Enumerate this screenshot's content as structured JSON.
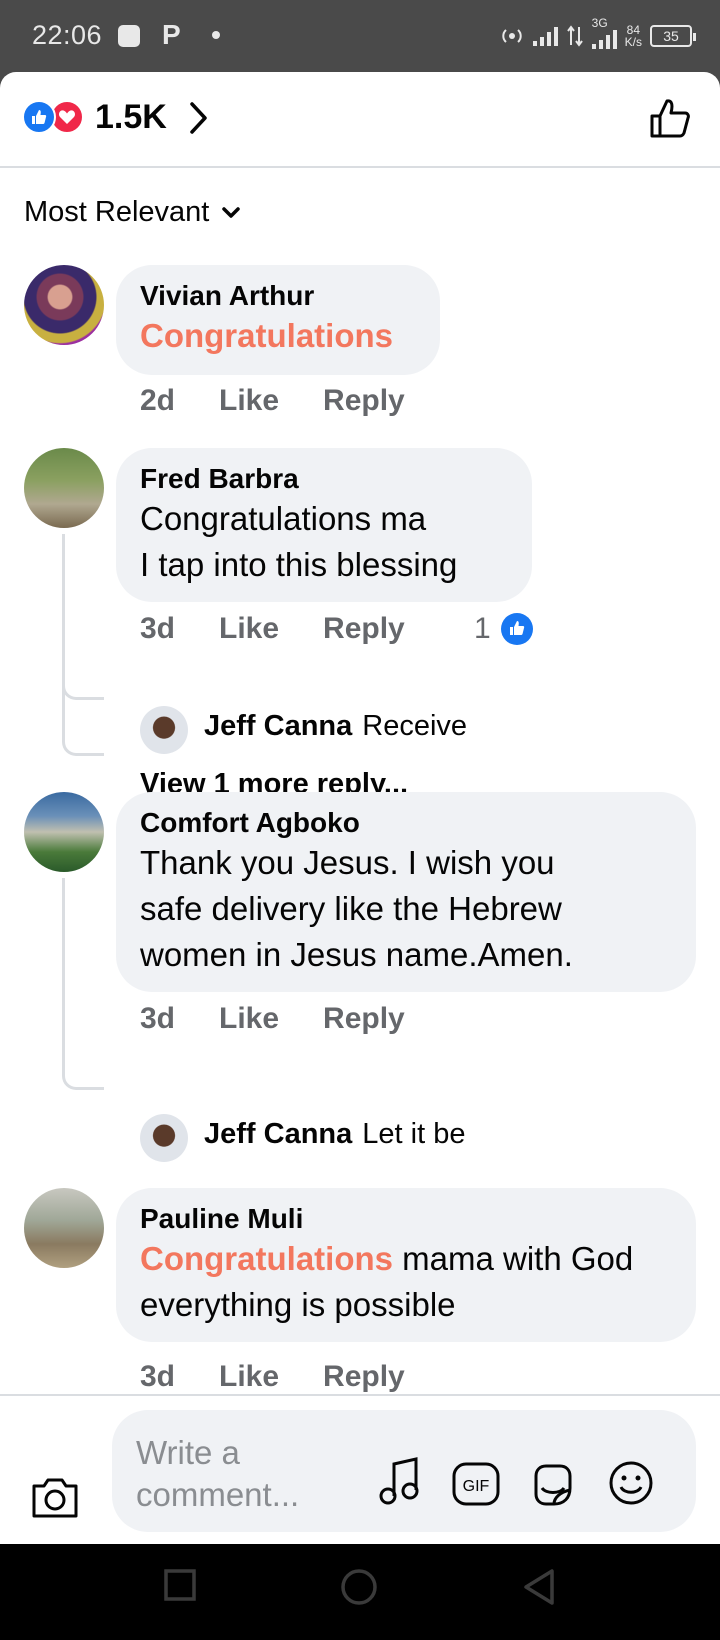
{
  "status_bar": {
    "time": "22:06",
    "p_glyph": "P",
    "net_gen": "3G",
    "net_speed_num": "84",
    "net_speed_unit": "K/s",
    "battery": "35"
  },
  "reactions": {
    "count": "1.5K",
    "icons": [
      "like-icon",
      "love-icon"
    ]
  },
  "sort": {
    "label": "Most Relevant"
  },
  "comments": [
    {
      "author": "Vivian Arthur",
      "text_highlight": "Congratulations",
      "text": "",
      "time": "2d",
      "like_label": "Like",
      "reply_label": "Reply"
    },
    {
      "author": "Fred Barbra",
      "text_line1": "Congratulations ma",
      "text_line2": "I tap into this blessing",
      "time": "3d",
      "like_label": "Like",
      "reply_label": "Reply",
      "like_count": "1",
      "replies": [
        {
          "author": "Jeff Canna",
          "text": "Receive"
        }
      ],
      "view_more": "View 1 more reply..."
    },
    {
      "author": "Comfort Agboko",
      "text_line1": "Thank you Jesus. I wish you",
      "text_line2": "safe delivery like the Hebrew",
      "text_line3": "women in Jesus name.Amen.",
      "time": "3d",
      "like_label": "Like",
      "reply_label": "Reply",
      "replies": [
        {
          "author": "Jeff Canna",
          "text": "Let it be"
        }
      ]
    },
    {
      "author": "Pauline Muli",
      "text_highlight": "Congratulations",
      "text_rest": " mama with God",
      "text_line2": "everything is possible",
      "time": "3d",
      "like_label": "Like",
      "reply_label": "Reply"
    }
  ],
  "composer": {
    "placeholder": "Write a comment...",
    "icons": [
      "camera-icon",
      "music-note-icon",
      "gif-icon",
      "sticker-icon",
      "emoji-icon"
    ]
  },
  "nav": {
    "icons": [
      "recents-square-icon",
      "home-circle-icon",
      "back-triangle-icon"
    ]
  },
  "colors": {
    "highlight": "#f3775e",
    "like_blue": "#1877f2",
    "love_red": "#f02849",
    "bubble": "#f0f2f5",
    "meta_gray": "#65676b"
  }
}
